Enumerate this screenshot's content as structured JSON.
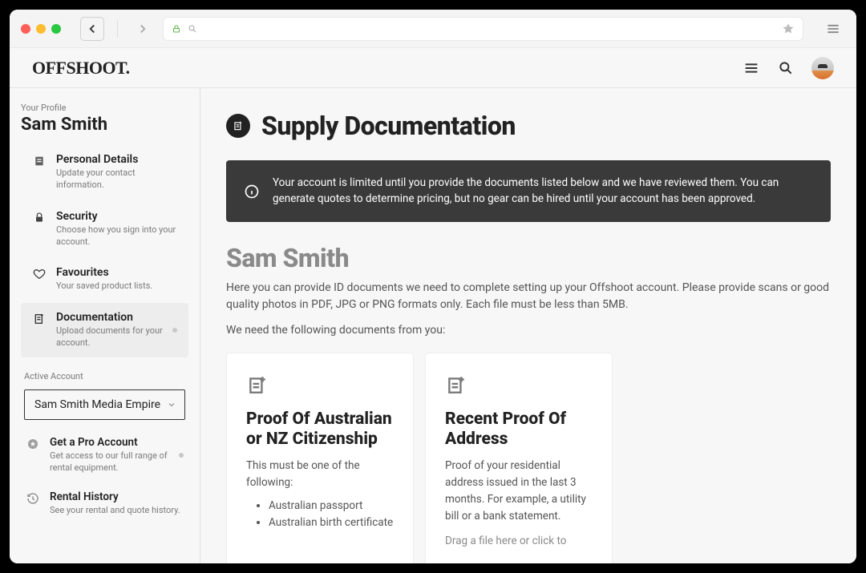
{
  "appHeader": {
    "logo": "OFFSHOOT."
  },
  "sidebar": {
    "profileLabel": "Your Profile",
    "profileName": "Sam Smith",
    "items": [
      {
        "title": "Personal Details",
        "sub": "Update your contact information."
      },
      {
        "title": "Security",
        "sub": "Choose how you sign into your account."
      },
      {
        "title": "Favourites",
        "sub": "Your saved product lists."
      },
      {
        "title": "Documentation",
        "sub": "Upload documents for your account."
      }
    ],
    "activeAccountLabel": "Active Account",
    "accountName": "Sam Smith Media Empire",
    "lowerItems": [
      {
        "title": "Get a Pro Account",
        "sub": "Get access to our full range of rental equipment."
      },
      {
        "title": "Rental History",
        "sub": "See your rental and quote history."
      }
    ]
  },
  "main": {
    "pageTitle": "Supply Documentation",
    "alertText": "Your account is limited until you provide the documents listed below and we have reviewed them. You can generate quotes to determine pricing, but no gear can be hired until your account has been approved.",
    "userHeading": "Sam Smith",
    "intro1": "Here you can provide ID documents we need to complete setting up your Offshoot account. Please provide scans or good quality photos in PDF, JPG or PNG formats only. Each file must be less than 5MB.",
    "intro2": "We need the following documents from you:",
    "cards": [
      {
        "title": "Proof Of Australian or NZ Citizenship",
        "text": "This must be one of the following:",
        "bullets": [
          "Australian passport",
          "Australian birth certificate"
        ]
      },
      {
        "title": "Recent Proof Of Address",
        "text": "Proof of your residential address issued in the last 3 months. For example, a utility bill or a bank statement.",
        "uploadHint": "Drag a file here or click to"
      }
    ]
  }
}
